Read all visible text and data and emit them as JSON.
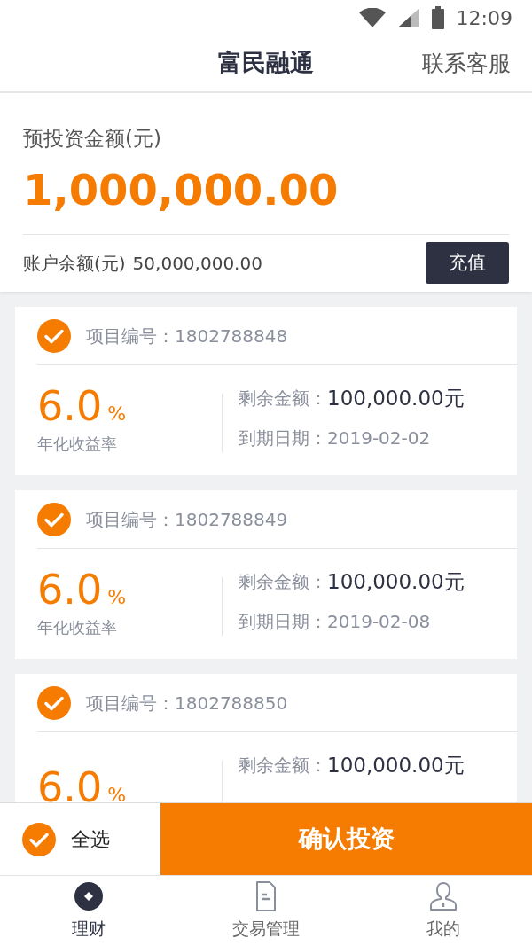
{
  "status_bar": {
    "time": "12:09"
  },
  "header": {
    "title": "富民融通",
    "action": "联系客服"
  },
  "summary": {
    "label": "预投资金额(元)",
    "amount": "1,000,000.00",
    "balance_label": "账户余额(元)",
    "balance": "50,000,000.00",
    "button": "充值"
  },
  "projects": [
    {
      "checked": true,
      "id_label": "项目编号：",
      "id": "1802788848",
      "rate": "6.0",
      "rate_unit": "%",
      "rate_label": "年化收益率",
      "remaining_label": "剩余金额：",
      "remaining": "100,000.00元",
      "due_label": "到期日期：",
      "due": "2019-02-02"
    },
    {
      "checked": true,
      "id_label": "项目编号：",
      "id": "1802788849",
      "rate": "6.0",
      "rate_unit": "%",
      "rate_label": "年化收益率",
      "remaining_label": "剩余金额：",
      "remaining": "100,000.00元",
      "due_label": "到期日期：",
      "due": "2019-02-08"
    },
    {
      "checked": true,
      "id_label": "项目编号：",
      "id": "1802788850",
      "rate": "6.0",
      "rate_unit": "%",
      "remaining_label": "剩余金额：",
      "remaining": "100,000.00元"
    }
  ],
  "action_bar": {
    "select_all": {
      "label": "全选",
      "checked": true
    },
    "confirm": "确认投资"
  },
  "tabs": [
    {
      "label": "理财",
      "kind": "coin",
      "selected": true
    },
    {
      "label": "交易管理",
      "kind": "document",
      "selected": false
    },
    {
      "label": "我的",
      "kind": "person",
      "selected": false
    }
  ]
}
